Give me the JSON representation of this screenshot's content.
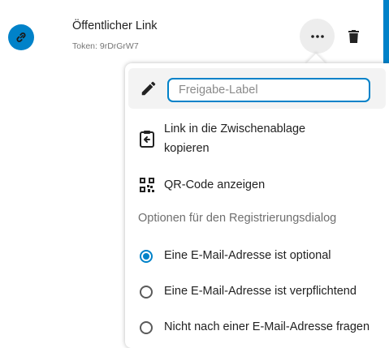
{
  "share": {
    "title": "Öffentlicher Link",
    "token": "Token: 9rDrGrW7",
    "icon": "link-icon"
  },
  "menu": {
    "label_placeholder": "Freigabe-Label",
    "label_value": "",
    "copy_link_line1": "Link in die Zwischenablage",
    "copy_link_line2": "kopieren",
    "qr_label": "QR-Code anzeigen",
    "options_caption": "Optionen für den Registrierungsdialog",
    "radio_options": [
      {
        "label": "Eine E-Mail-Adresse ist optional",
        "checked": true
      },
      {
        "label": "Eine E-Mail-Adresse ist verpflichtend",
        "checked": false
      },
      {
        "label": "Nicht nach einer E-Mail-Adresse fragen",
        "checked": false
      }
    ]
  },
  "colors": {
    "accent": "#0082c9",
    "hover_background": "#ededed"
  }
}
